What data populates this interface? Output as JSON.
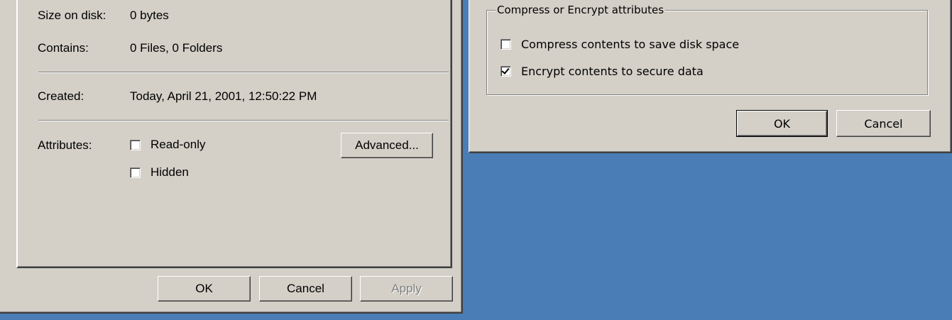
{
  "properties": {
    "size_on_disk": {
      "label": "Size on disk:",
      "value": "0 bytes"
    },
    "contains": {
      "label": "Contains:",
      "value": "0 Files, 0 Folders"
    },
    "created": {
      "label": "Created:",
      "value": "Today, April 21, 2001, 12:50:22 PM"
    },
    "attributes": {
      "label": "Attributes:",
      "readonly": {
        "label": "Read-only",
        "checked": false
      },
      "hidden": {
        "label": "Hidden",
        "checked": false
      },
      "advanced_button": "Advanced..."
    },
    "buttons": {
      "ok": "OK",
      "cancel": "Cancel",
      "apply": "Apply"
    }
  },
  "advanced": {
    "group_title": "Compress or Encrypt attributes",
    "compress": {
      "label": "Compress contents to save disk space",
      "checked": false
    },
    "encrypt": {
      "label": "Encrypt contents to secure data",
      "checked": true
    },
    "buttons": {
      "ok": "OK",
      "cancel": "Cancel"
    }
  },
  "colors": {
    "desktop": "#4a7db5",
    "dialog_face": "#d4d0c8",
    "disabled_text": "#808080"
  }
}
